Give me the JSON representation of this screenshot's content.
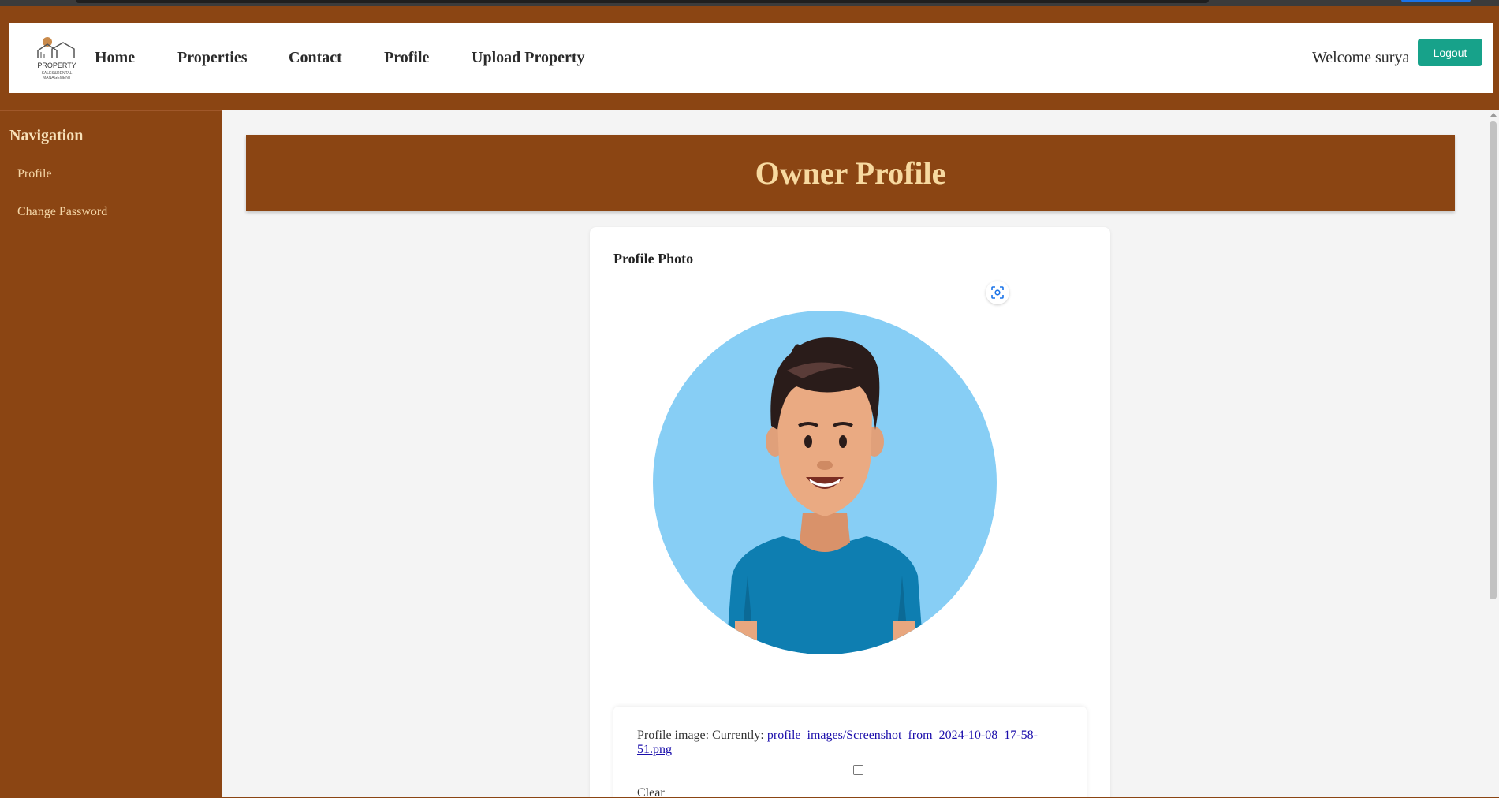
{
  "header": {
    "logo_text": "PROPERTY SALES & RENTAL MANAGEMENT",
    "nav": [
      "Home",
      "Properties",
      "Contact",
      "Profile",
      "Upload Property"
    ],
    "welcome": "Welcome surya",
    "logout_label": "Logout"
  },
  "sidebar": {
    "title": "Navigation",
    "items": [
      "Profile",
      "Change Password"
    ]
  },
  "main": {
    "banner_title": "Owner Profile",
    "card_title": "Profile Photo",
    "form": {
      "image_label": "Profile image: Currently:",
      "image_link": "profile_images/Screenshot_from_2024-10-08_17-58-51.png",
      "clear_label": "Clear"
    }
  },
  "colors": {
    "brand_brown": "#8b4513",
    "banner_text": "#f7d9a0",
    "logout_green": "#17a28a"
  }
}
